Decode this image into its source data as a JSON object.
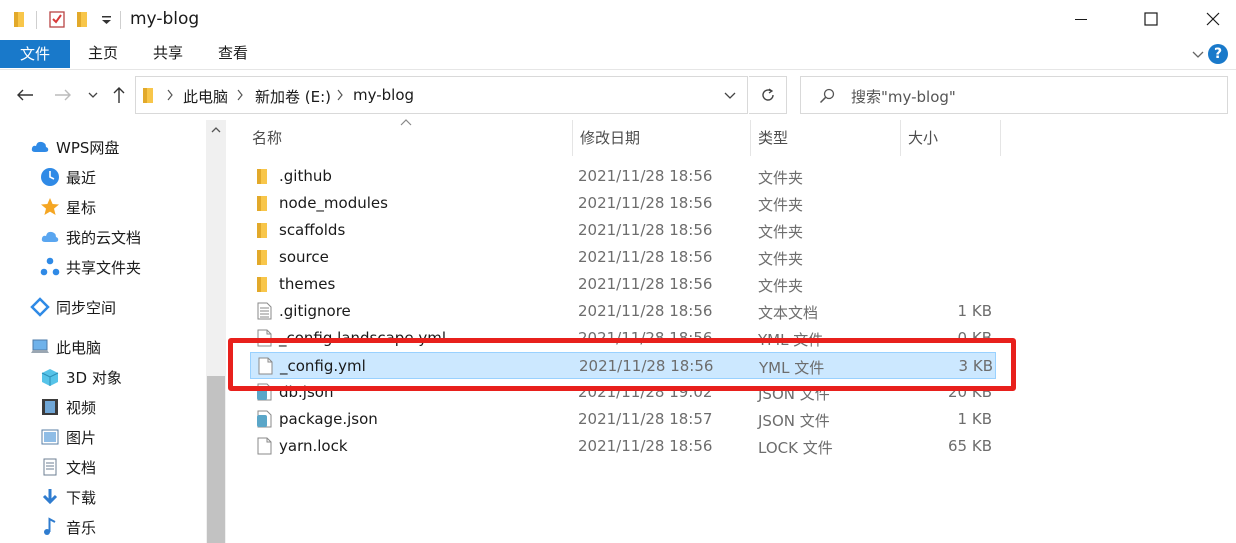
{
  "window": {
    "title": "my-blog"
  },
  "ribbon": {
    "tabs": [
      {
        "label": "文件",
        "active": true
      },
      {
        "label": "主页",
        "active": false
      },
      {
        "label": "共享",
        "active": false
      },
      {
        "label": "查看",
        "active": false
      }
    ],
    "help_label": "?"
  },
  "address": {
    "breadcrumbs": [
      "此电脑",
      "新加卷 (E:)",
      "my-blog"
    ]
  },
  "search": {
    "placeholder": "搜索\"my-blog\""
  },
  "nav_pane": {
    "items": [
      {
        "label": "WPS网盘",
        "icon": "cloud-icon"
      },
      {
        "label": "最近",
        "icon": "clock-icon"
      },
      {
        "label": "星标",
        "icon": "star-icon"
      },
      {
        "label": "我的云文档",
        "icon": "cloud-doc-icon"
      },
      {
        "label": "共享文件夹",
        "icon": "share-icon"
      },
      {
        "label": "同步空间",
        "icon": "sync-icon"
      },
      {
        "label": "此电脑",
        "icon": "computer-icon"
      },
      {
        "label": "3D 对象",
        "icon": "cube-icon"
      },
      {
        "label": "视频",
        "icon": "video-icon"
      },
      {
        "label": "图片",
        "icon": "picture-icon"
      },
      {
        "label": "文档",
        "icon": "document-icon"
      },
      {
        "label": "下载",
        "icon": "download-icon"
      },
      {
        "label": "音乐",
        "icon": "music-icon"
      }
    ]
  },
  "columns": {
    "name": "名称",
    "date": "修改日期",
    "type": "类型",
    "size": "大小"
  },
  "files": [
    {
      "name": ".github",
      "date": "2021/11/28 18:56",
      "type": "文件夹",
      "size": "",
      "icon": "folder-icon"
    },
    {
      "name": "node_modules",
      "date": "2021/11/28 18:56",
      "type": "文件夹",
      "size": "",
      "icon": "folder-icon"
    },
    {
      "name": "scaffolds",
      "date": "2021/11/28 18:56",
      "type": "文件夹",
      "size": "",
      "icon": "folder-icon"
    },
    {
      "name": "source",
      "date": "2021/11/28 18:56",
      "type": "文件夹",
      "size": "",
      "icon": "folder-icon"
    },
    {
      "name": "themes",
      "date": "2021/11/28 18:56",
      "type": "文件夹",
      "size": "",
      "icon": "folder-icon"
    },
    {
      "name": ".gitignore",
      "date": "2021/11/28 18:56",
      "type": "文本文档",
      "size": "1 KB",
      "icon": "text-file-icon"
    },
    {
      "name": "_config.landscape.yml",
      "date": "2021/11/28 18:56",
      "type": "YML 文件",
      "size": "0 KB",
      "icon": "file-icon"
    },
    {
      "name": "_config.yml",
      "date": "2021/11/28 18:56",
      "type": "YML 文件",
      "size": "3 KB",
      "icon": "file-icon",
      "selected": true
    },
    {
      "name": "db.json",
      "date": "2021/11/28 19:02",
      "type": "JSON 文件",
      "size": "20 KB",
      "icon": "json-file-icon"
    },
    {
      "name": "package.json",
      "date": "2021/11/28 18:57",
      "type": "JSON 文件",
      "size": "1 KB",
      "icon": "json-file-icon"
    },
    {
      "name": "yarn.lock",
      "date": "2021/11/28 18:56",
      "type": "LOCK 文件",
      "size": "65 KB",
      "icon": "file-icon"
    }
  ],
  "colors": {
    "accent": "#1979ca",
    "selection_bg": "#cce8ff",
    "highlight_border": "#e8201c",
    "folder": "#f8c64a"
  }
}
